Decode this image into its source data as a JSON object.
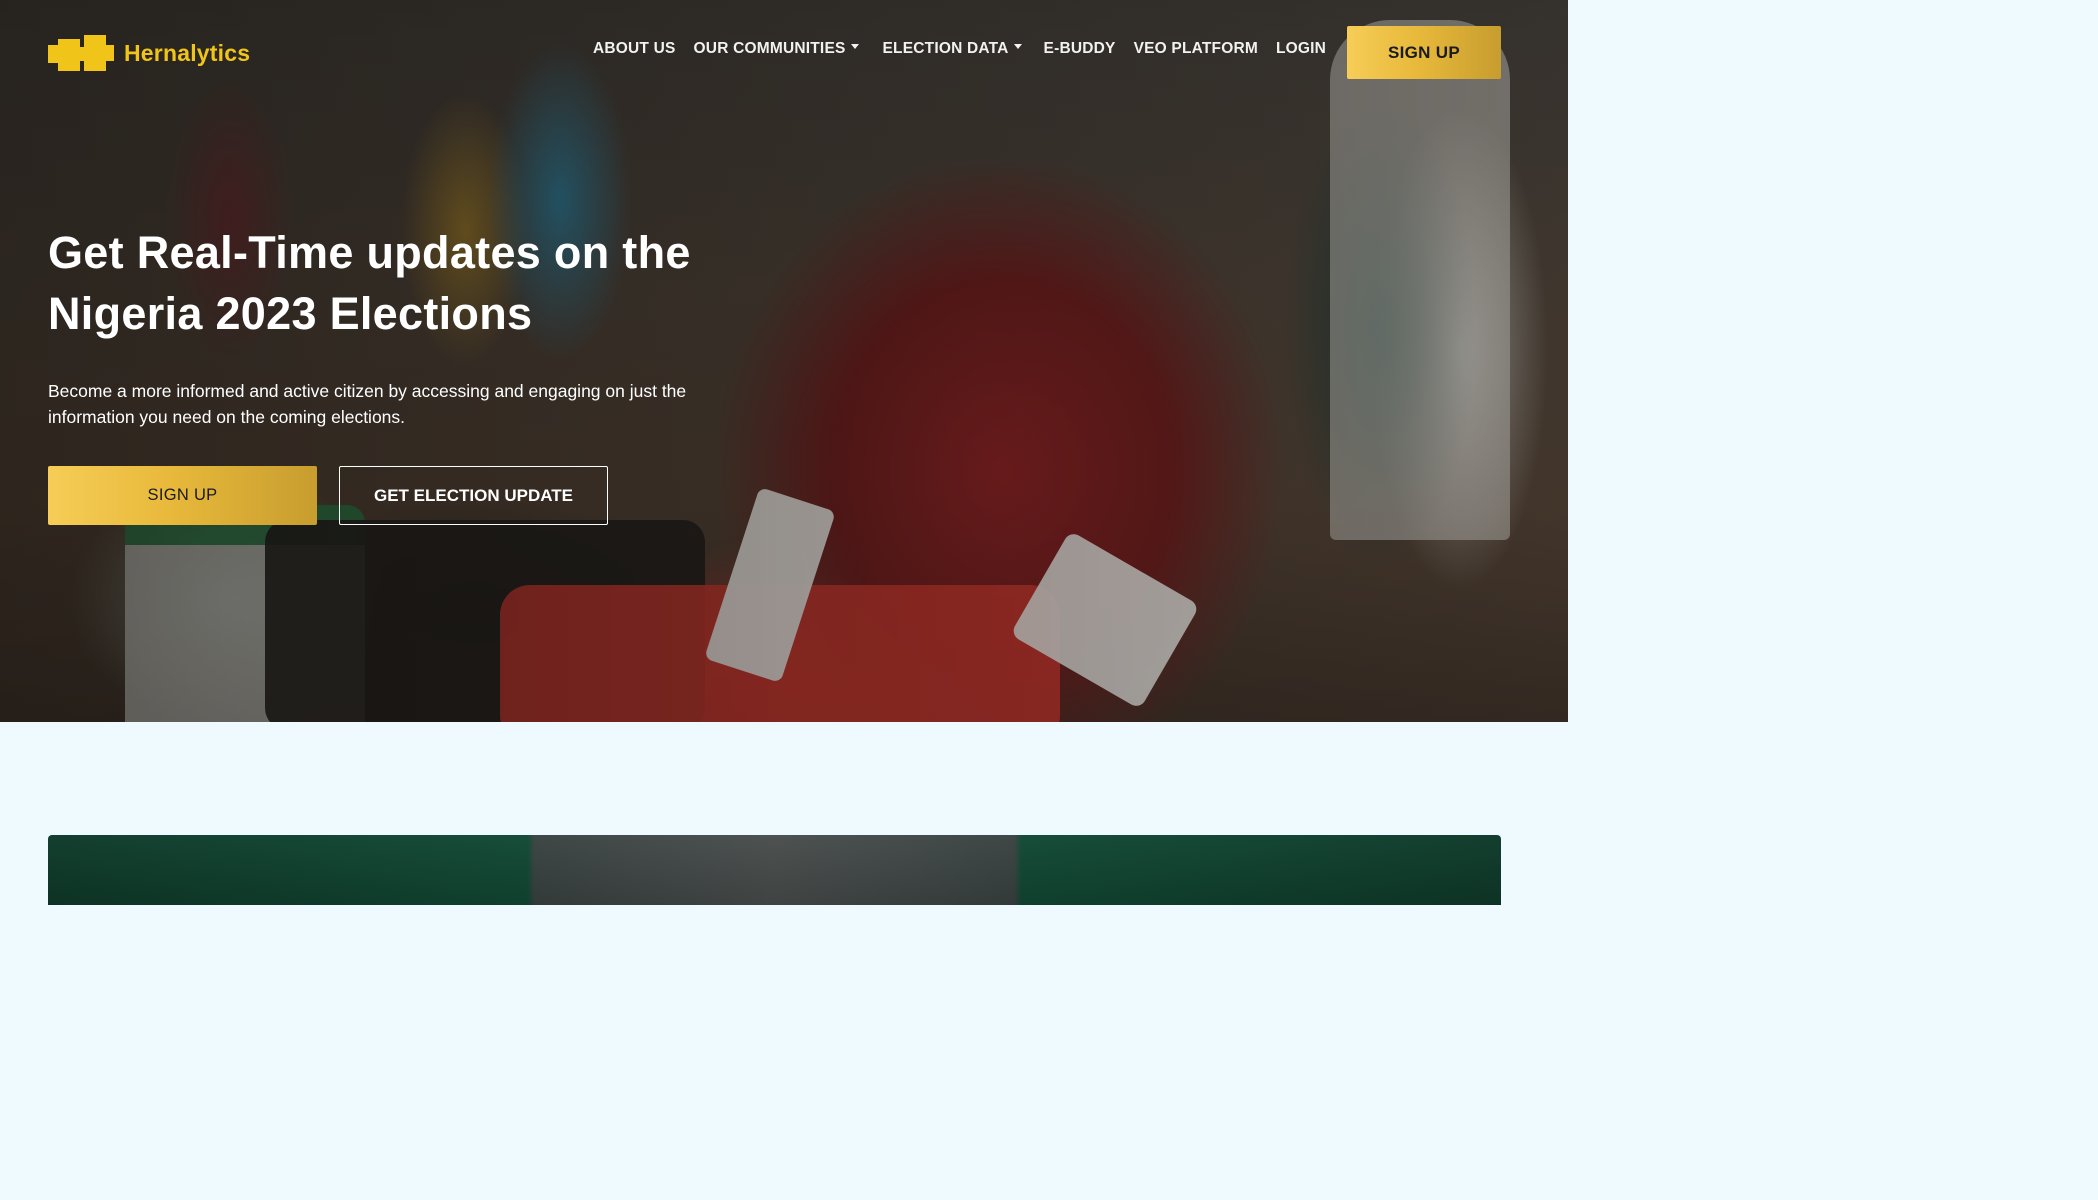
{
  "brand": {
    "name": "Hernalytics",
    "color": "#f0c419"
  },
  "nav": {
    "items": [
      {
        "label": "ABOUT US",
        "dropdown": false
      },
      {
        "label": "OUR COMMUNITIES",
        "dropdown": true
      },
      {
        "label": "ELECTION DATA",
        "dropdown": true
      },
      {
        "label": "E-BUDDY",
        "dropdown": false
      },
      {
        "label": "VEO PLATFORM",
        "dropdown": false
      },
      {
        "label": "LOGIN",
        "dropdown": false
      }
    ],
    "signup_label": "SIGN UP"
  },
  "hero": {
    "headline_line1": "Get Real-Time updates on the",
    "headline_line2": "Nigeria 2023 Elections",
    "subtext": "Become a more informed and active citizen by accessing and engaging on just the information you need on the coming elections.",
    "primary_cta": "SIGN UP",
    "secondary_cta": "GET ELECTION UPDATE"
  },
  "colors": {
    "accent_gold": "#e8b93b",
    "page_background": "#eefaff",
    "banner_green": "#124a35"
  }
}
